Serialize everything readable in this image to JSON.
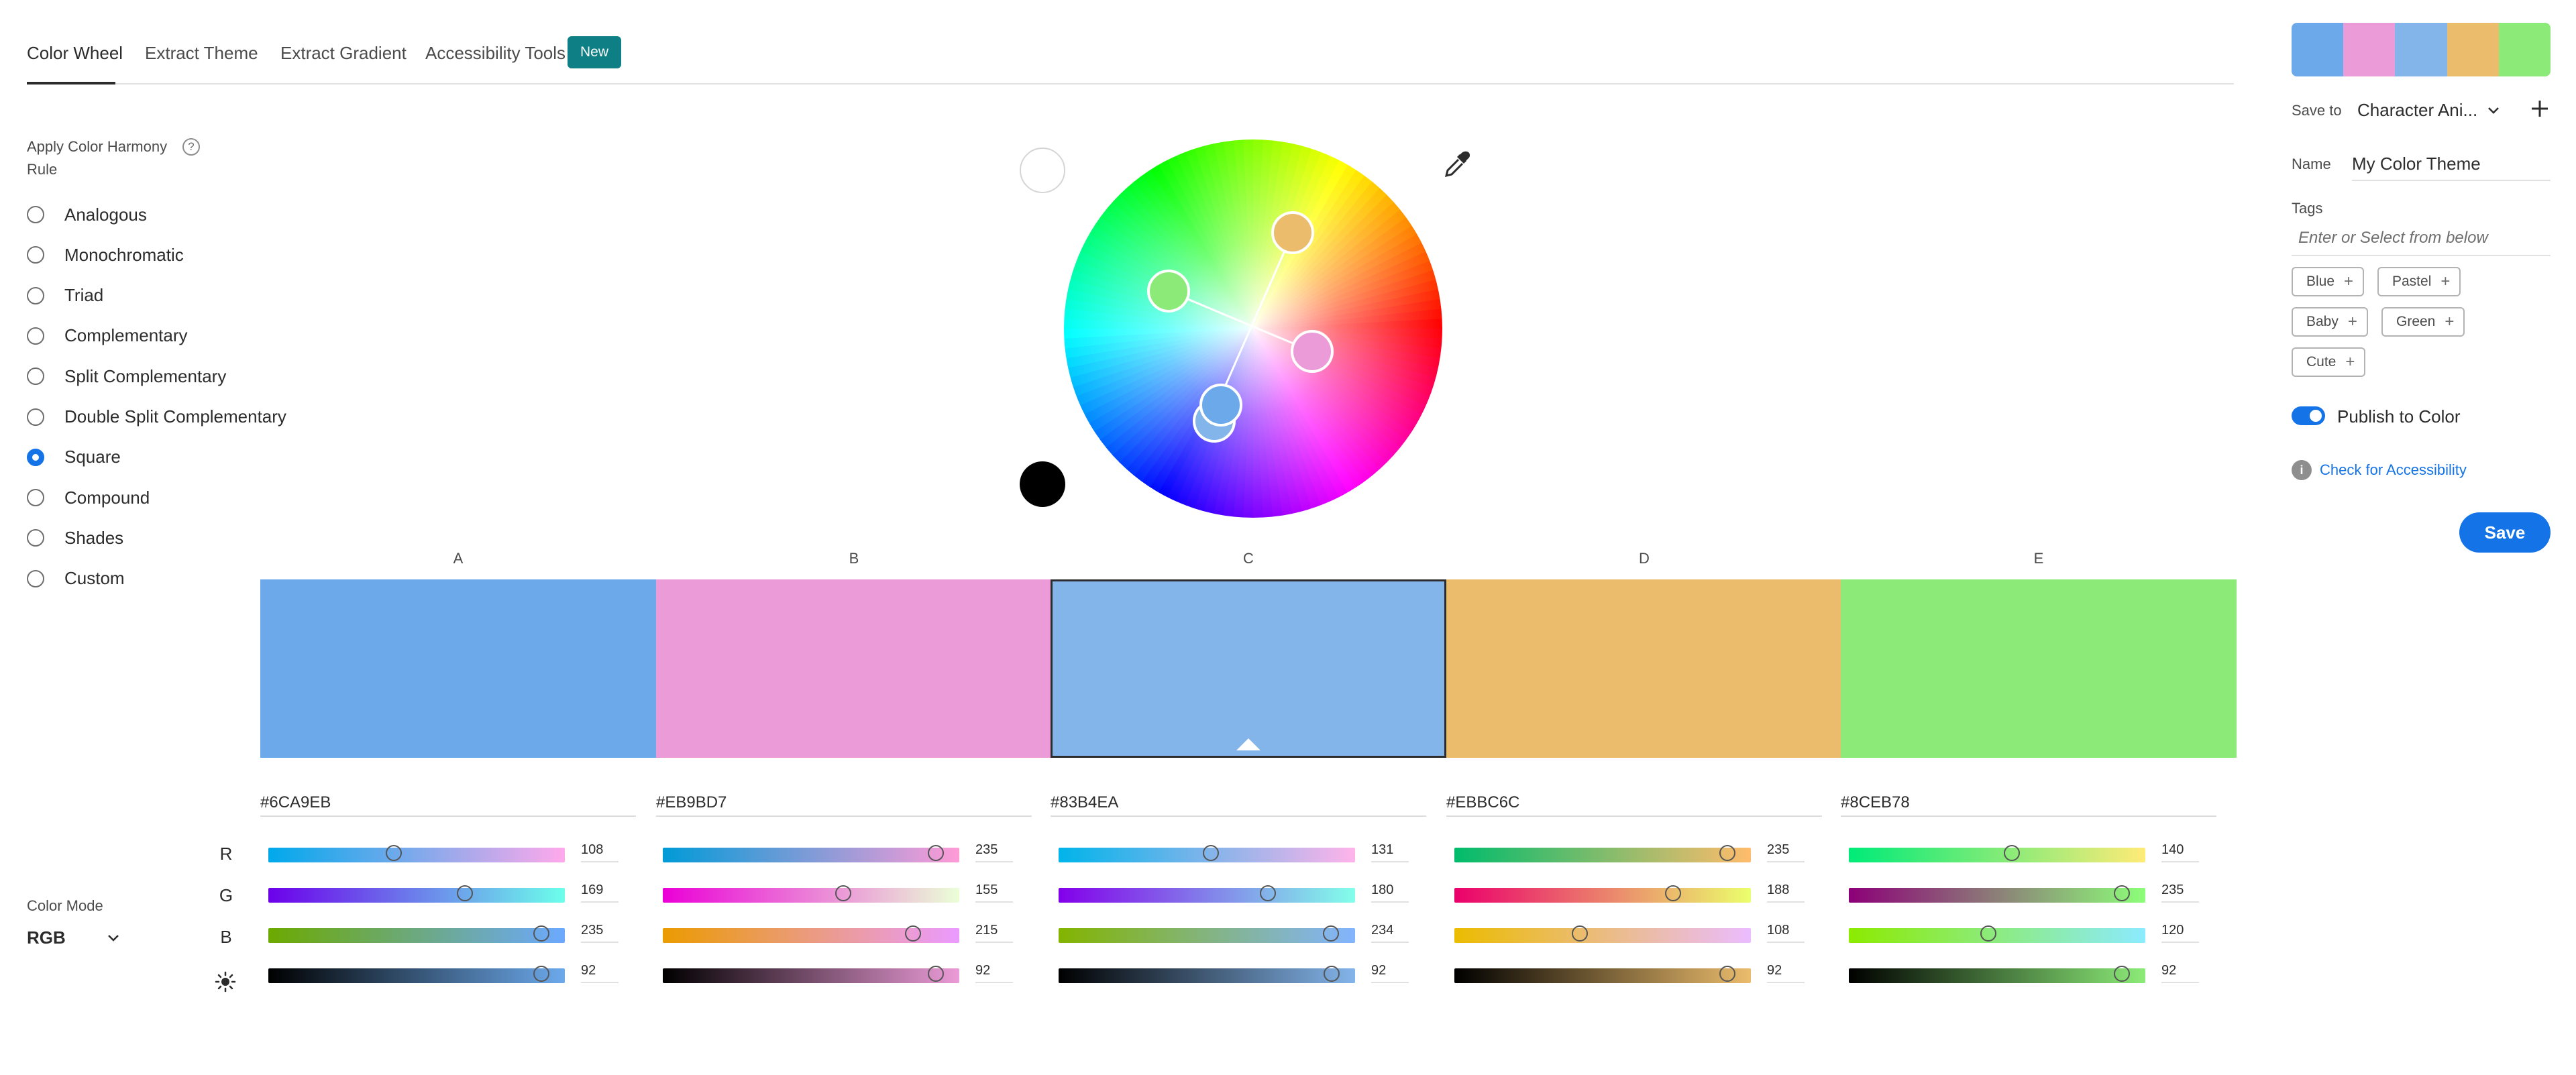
{
  "tabs": [
    {
      "label": "Color Wheel",
      "active": true
    },
    {
      "label": "Extract Theme",
      "active": false
    },
    {
      "label": "Extract Gradient",
      "active": false
    },
    {
      "label": "Accessibility Tools",
      "active": false
    }
  ],
  "new_badge": "New",
  "harmony": {
    "title": "Apply Color Harmony Rule",
    "help_icon": "?",
    "rules": [
      "Analogous",
      "Monochromatic",
      "Triad",
      "Complementary",
      "Split Complementary",
      "Double Split Complementary",
      "Square",
      "Compound",
      "Shades",
      "Custom"
    ],
    "selected": "Square"
  },
  "color_mode": {
    "label": "Color Mode",
    "value": "RGB"
  },
  "channels": [
    "R",
    "G",
    "B"
  ],
  "brightness_icon": "sun-icon",
  "swatches": [
    {
      "letter": "A",
      "hex": "#6CA9EB",
      "color": "#6CA9EB",
      "r": 108,
      "g": 169,
      "b": 235,
      "brightness": 92
    },
    {
      "letter": "B",
      "hex": "#EB9BD7",
      "color": "#EB9BD7",
      "r": 235,
      "g": 155,
      "b": 215,
      "brightness": 92
    },
    {
      "letter": "C",
      "hex": "#83B4EA",
      "color": "#83B4EA",
      "r": 131,
      "g": 180,
      "b": 234,
      "brightness": 92,
      "selected": true
    },
    {
      "letter": "D",
      "hex": "#EBBC6C",
      "color": "#EBBC6C",
      "r": 235,
      "g": 188,
      "b": 108,
      "brightness": 92
    },
    {
      "letter": "E",
      "hex": "#8CEB78",
      "color": "#8CEB78",
      "r": 140,
      "g": 235,
      "b": 120,
      "brightness": 92
    }
  ],
  "right_panel": {
    "save_to_label": "Save to",
    "save_to_value": "Character Ani...",
    "name_label": "Name",
    "name_value": "My Color Theme",
    "tags_label": "Tags",
    "tags_placeholder": "Enter or Select from below",
    "tags": [
      "Blue",
      "Pastel",
      "Baby",
      "Green",
      "Cute"
    ],
    "publish_label": "Publish to Color",
    "publish_on": true,
    "accessibility_link": "Check for Accessibility",
    "save_button": "Save"
  }
}
